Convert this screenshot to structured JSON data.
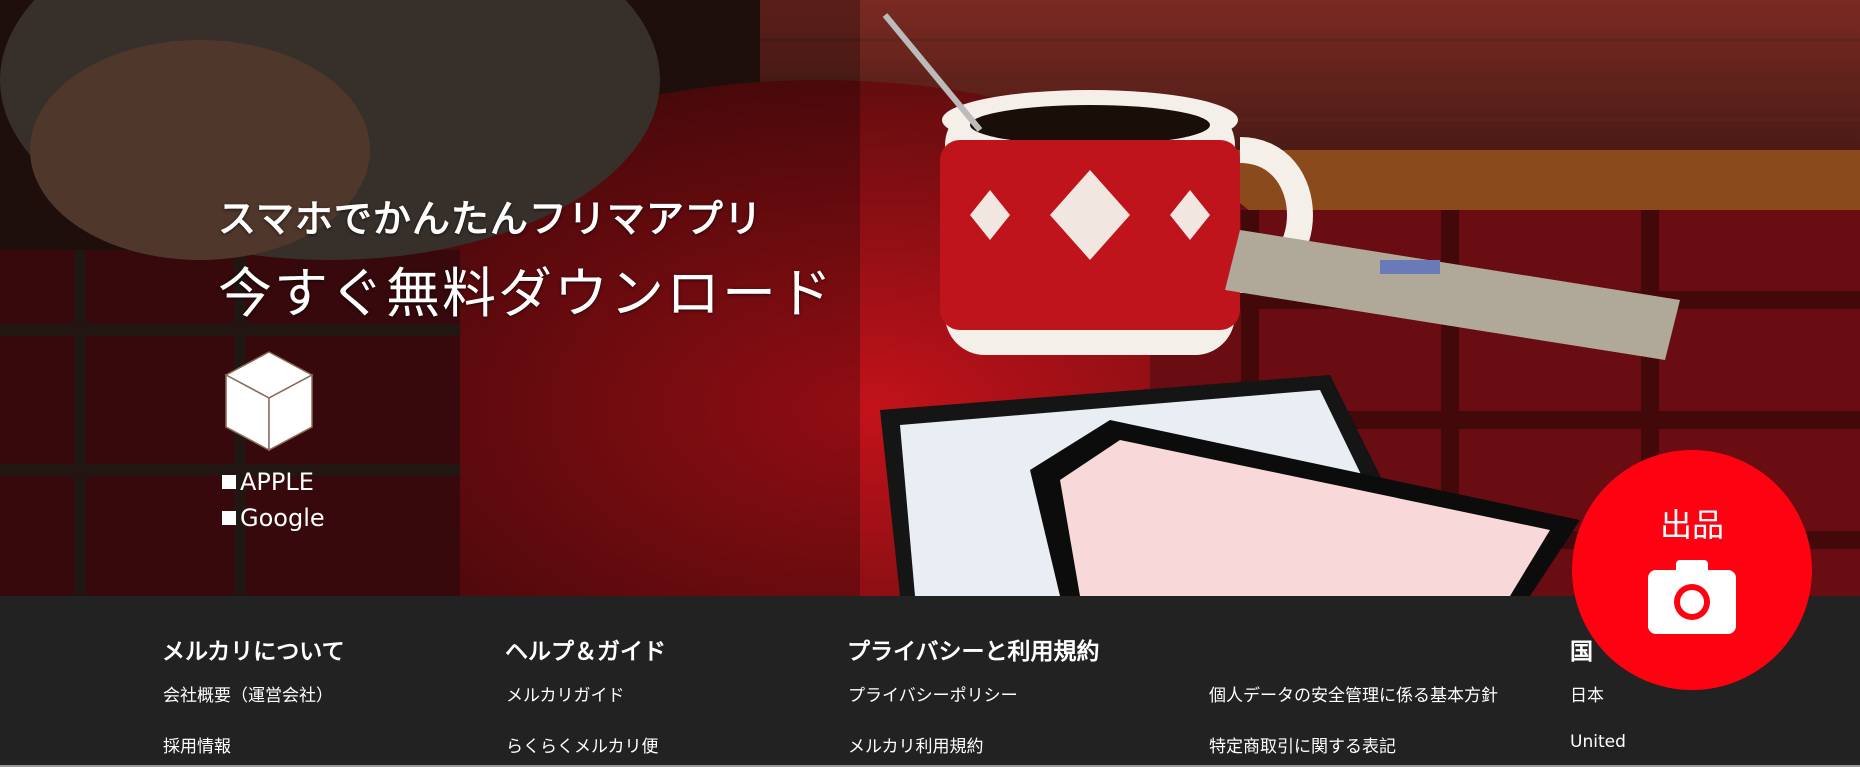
{
  "hero": {
    "subtitle": "スマホでかんたんフリマアプリ",
    "title": "今すぐ無料ダウンロード",
    "store_links": [
      {
        "label": "APPLE"
      },
      {
        "label": "Google"
      }
    ]
  },
  "sell_button": {
    "label": "出品",
    "icon": "camera-icon"
  },
  "footer": {
    "about": {
      "heading": "メルカリについて",
      "links": [
        "会社概要（運営会社）",
        "採用情報"
      ]
    },
    "help": {
      "heading": "ヘルプ＆ガイド",
      "links": [
        "メルカリガイド",
        "らくらくメルカリ便"
      ]
    },
    "privacy": {
      "heading": "プライバシーと利用規約",
      "links": [
        "プライバシーポリシー",
        "メルカリ利用規約",
        "個人データの安全管理に係る基本方針",
        "特定商取引に関する表記"
      ]
    },
    "country": {
      "heading": "国",
      "links": [
        "日本",
        "United"
      ]
    }
  },
  "colors": {
    "accent": "#ff0211",
    "footer_bg": "#222222",
    "text": "#ffffff"
  }
}
